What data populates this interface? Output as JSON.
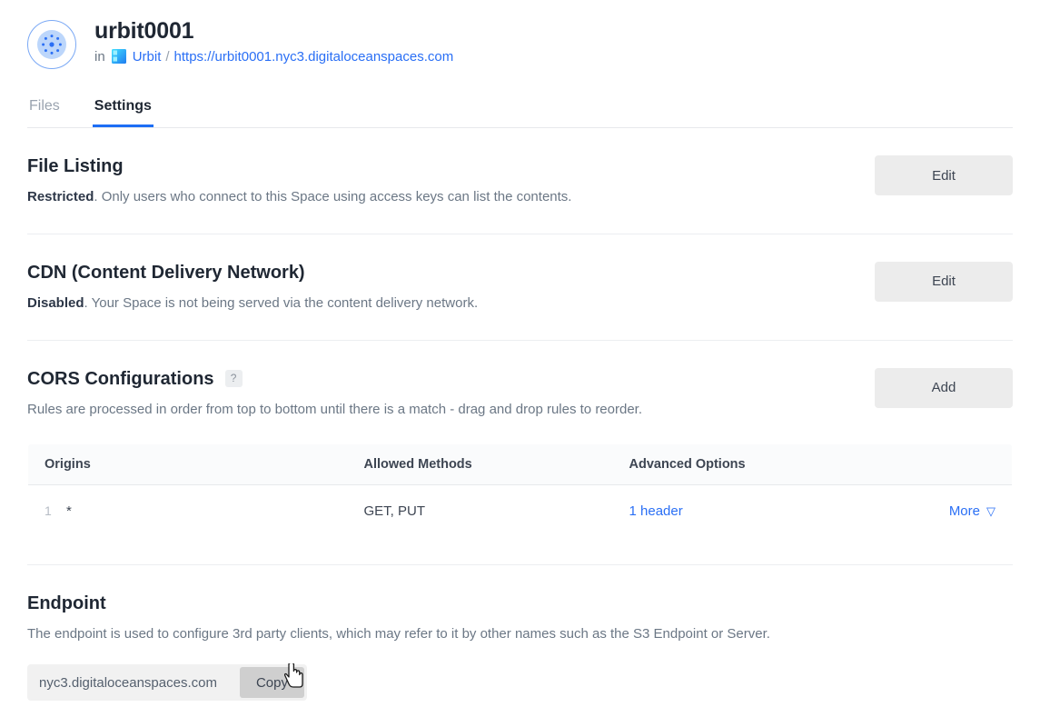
{
  "header": {
    "avatar_icon": "space-dots-icon",
    "title": "urbit0001",
    "breadcrumb": {
      "prefix": "in",
      "project_icon": "project-tile-icon",
      "project": "Urbit",
      "separator": "/",
      "url": "https://urbit0001.nyc3.digitaloceanspaces.com"
    }
  },
  "tabs": [
    {
      "label": "Files",
      "active": false
    },
    {
      "label": "Settings",
      "active": true
    }
  ],
  "sections": {
    "file_listing": {
      "title": "File Listing",
      "status": "Restricted",
      "desc": ". Only users who connect to this Space using access keys can list the contents.",
      "button": "Edit"
    },
    "cdn": {
      "title": "CDN (Content Delivery Network)",
      "status": "Disabled",
      "desc": ". Your Space is not being served via the content delivery network.",
      "button": "Edit"
    },
    "cors": {
      "title": "CORS Configurations",
      "help_icon": "?",
      "desc": "Rules are processed in order from top to bottom until there is a match - drag and drop rules to reorder.",
      "button": "Add",
      "table": {
        "columns": [
          "Origins",
          "Allowed Methods",
          "Advanced Options",
          ""
        ],
        "rows": [
          {
            "number": "1",
            "origin": "*",
            "methods": "GET, PUT",
            "advanced": "1 header",
            "more": "More",
            "chevron": "chevron-down-icon"
          }
        ]
      }
    },
    "endpoint": {
      "title": "Endpoint",
      "desc": "The endpoint is used to configure 3rd party clients, which may refer to it by other names such as the S3 Endpoint or Server.",
      "value": "nyc3.digitaloceanspaces.com",
      "copy_button": "Copy"
    }
  },
  "colors": {
    "link_blue": "#2a6ff5",
    "tab_active_underline": "#1d6ef5",
    "button_grey": "#ececec",
    "copy_button_grey": "#cfcfcf",
    "text_dark": "#1f2733",
    "text_muted": "#6b7785"
  },
  "cursor": {
    "icon": "pointer-hand-cursor"
  }
}
